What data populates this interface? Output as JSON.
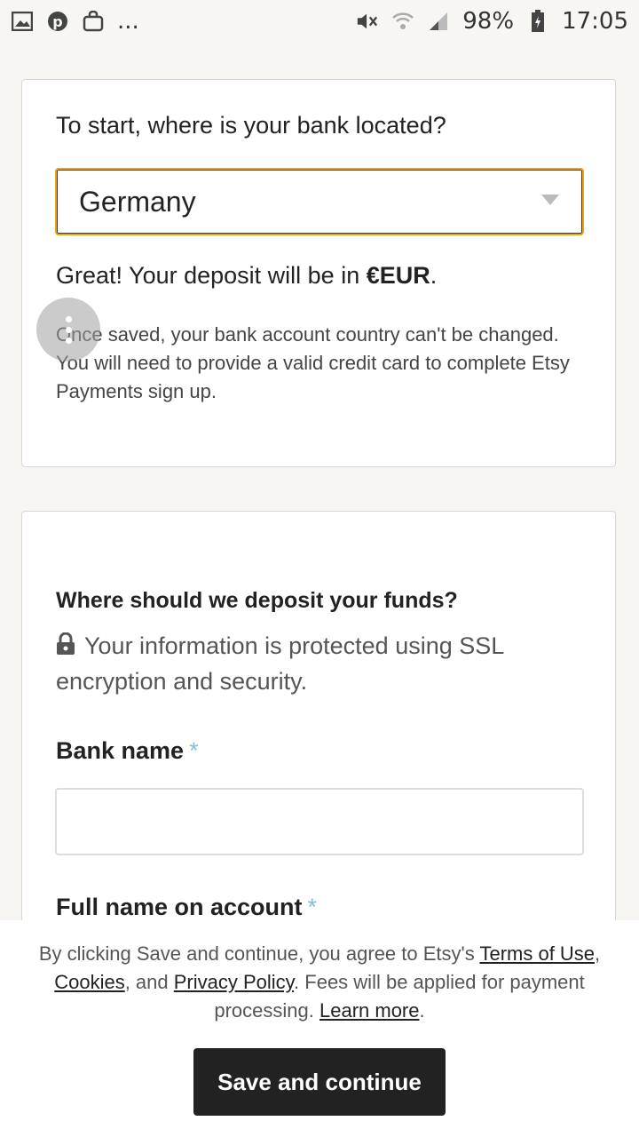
{
  "status_bar": {
    "left_icons": [
      "image-icon",
      "pinterest-icon",
      "shopping-bag-icon"
    ],
    "overflow": "...",
    "battery": "98%",
    "time": "17:05"
  },
  "bank_location": {
    "question": "To start, where is your bank located?",
    "selected_country": "Germany",
    "deposit_note_prefix": "Great! Your deposit will be in ",
    "currency": "€EUR",
    "deposit_note_suffix": ".",
    "info_line1": "Once saved, your bank account country can't be changed.",
    "info_line2": "You will need to provide a valid credit card to complete Etsy Payments sign up."
  },
  "deposit": {
    "title": "Where should we deposit your funds?",
    "ssl_note": "Your information is protected using SSL encryption and security.",
    "bank_name_label": "Bank name",
    "full_name_label": "Full name on account",
    "required_mark": "*"
  },
  "footer": {
    "legal_prefix": "By clicking Save and continue, you agree to Etsy's ",
    "terms_link": "Terms of Use",
    "sep1": ", ",
    "cookies_link": "Cookies",
    "sep2": ", and ",
    "privacy_link": "Privacy Policy",
    "legal_middle": ". Fees will be applied for payment processing. ",
    "learn_more_link": "Learn more",
    "legal_end": ".",
    "save_button": "Save and continue"
  }
}
